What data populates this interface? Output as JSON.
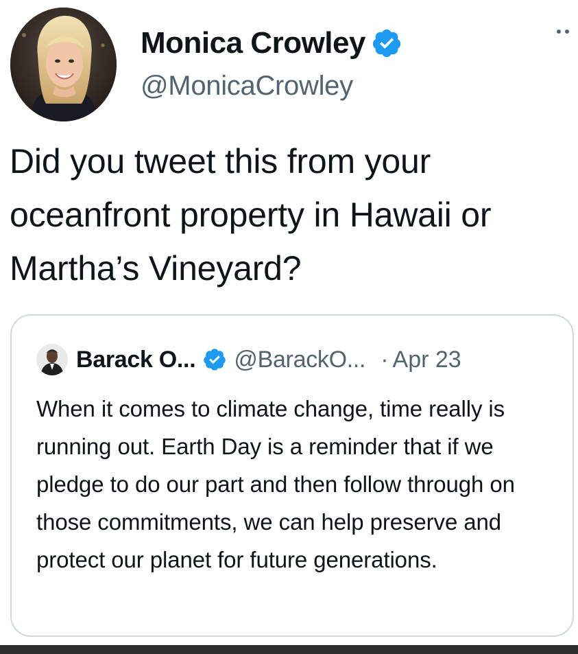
{
  "tweet": {
    "author": {
      "name": "Monica Crowley",
      "handle": "@MonicaCrowley",
      "verified": true
    },
    "text": "Did you tweet this from your oceanfront property in Hawaii or Martha’s Vineyard?",
    "more_icon": "more-horizontal-icon"
  },
  "quoted_tweet": {
    "author": {
      "name": "Barack O...",
      "handle": "@BarackO...",
      "verified": true
    },
    "separator": "·",
    "date": "Apr 23",
    "text": "When it comes to climate change, time really is running out. Earth Day is a reminder that if we pledge to do our part and then follow through on those commitments, we can help preserve and protect our planet for future generations."
  },
  "colors": {
    "verified_blue": "#1d9bf0",
    "text_primary": "#0f1419",
    "text_secondary": "#536471",
    "card_border": "#cfd9de"
  }
}
